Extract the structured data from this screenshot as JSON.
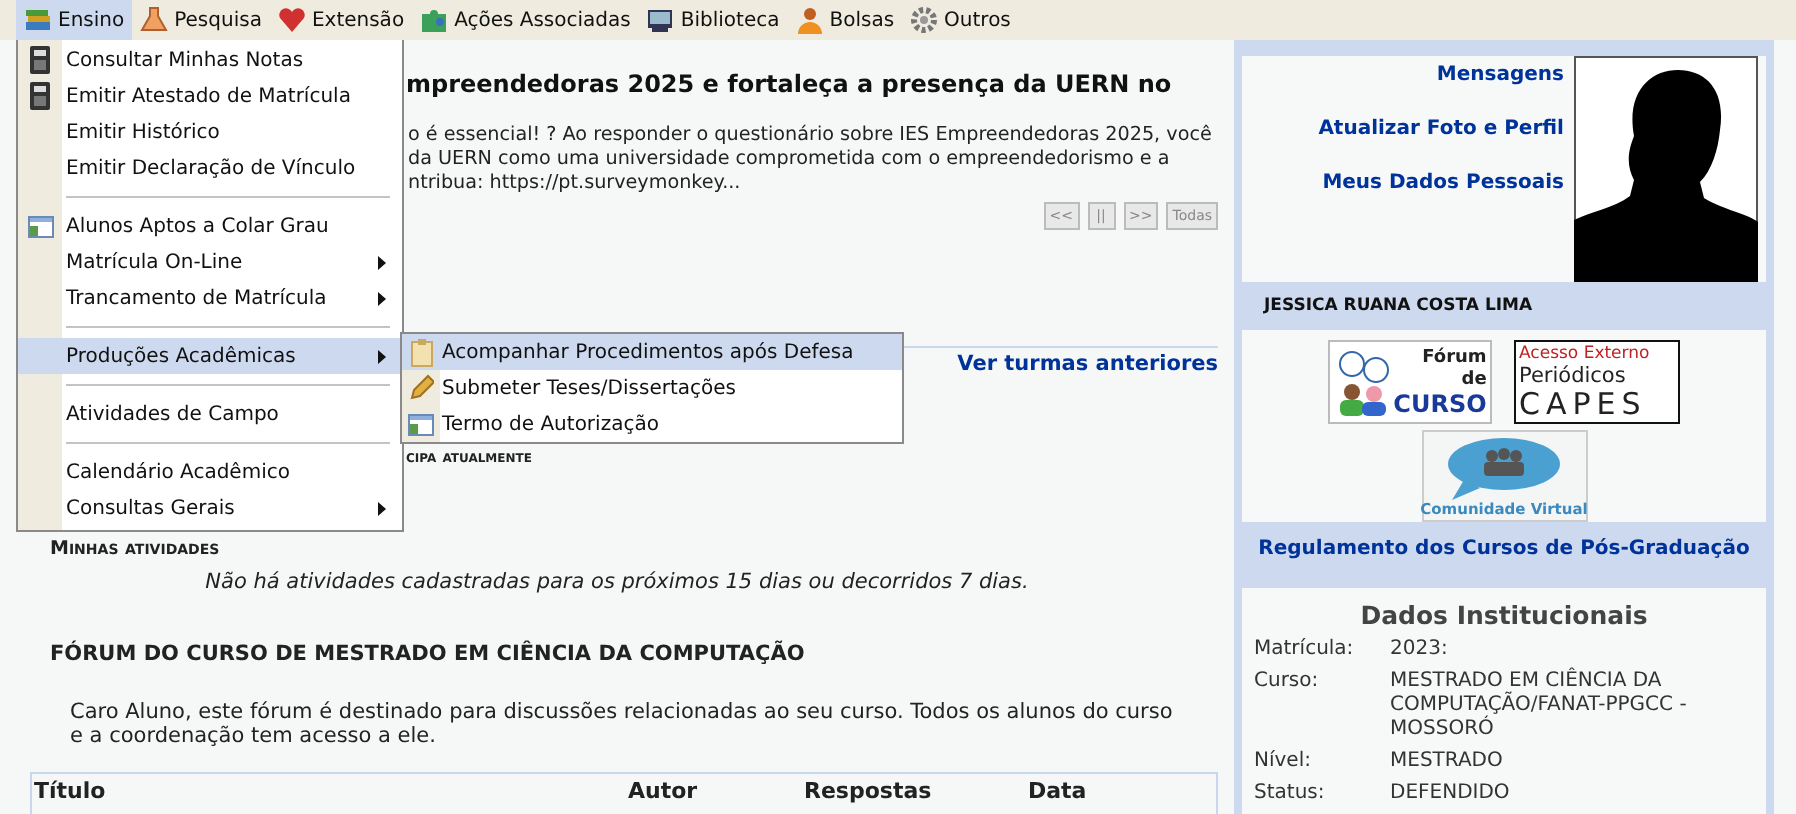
{
  "menubar": [
    {
      "label": "Ensino",
      "selected": true
    },
    {
      "label": "Pesquisa",
      "selected": false
    },
    {
      "label": "Extensão",
      "selected": false
    },
    {
      "label": "Ações Associadas",
      "selected": false
    },
    {
      "label": "Biblioteca",
      "selected": false
    },
    {
      "label": "Bolsas",
      "selected": false
    },
    {
      "label": "Outros",
      "selected": false
    }
  ],
  "dropdown": [
    {
      "kind": "item",
      "label": "Consultar Minhas Notas",
      "submenu": false,
      "selected": false
    },
    {
      "kind": "item",
      "label": "Emitir Atestado de Matrícula",
      "submenu": false,
      "selected": false
    },
    {
      "kind": "item",
      "label": "Emitir Histórico",
      "submenu": false,
      "selected": false
    },
    {
      "kind": "item",
      "label": "Emitir Declaração de Vínculo",
      "submenu": false,
      "selected": false
    },
    {
      "kind": "separator"
    },
    {
      "kind": "item",
      "label": "Alunos Aptos a Colar Grau",
      "submenu": false,
      "selected": false
    },
    {
      "kind": "item",
      "label": "Matrícula On-Line",
      "submenu": true,
      "selected": false
    },
    {
      "kind": "item",
      "label": "Trancamento de Matrícula",
      "submenu": true,
      "selected": false
    },
    {
      "kind": "separator"
    },
    {
      "kind": "item",
      "label": "Produções Acadêmicas",
      "submenu": true,
      "selected": true
    },
    {
      "kind": "separator"
    },
    {
      "kind": "item",
      "label": "Atividades de Campo",
      "submenu": false,
      "selected": false
    },
    {
      "kind": "separator"
    },
    {
      "kind": "item",
      "label": "Calendário Acadêmico",
      "submenu": false,
      "selected": false
    },
    {
      "kind": "item",
      "label": "Consultas Gerais",
      "submenu": true,
      "selected": false
    }
  ],
  "submenu": [
    {
      "label": "Acompanhar Procedimentos após Defesa",
      "selected": true
    },
    {
      "label": "Submeter Teses/Dissertações",
      "selected": false
    },
    {
      "label": "Termo de Autorização",
      "selected": false
    }
  ],
  "news": {
    "title": "mpreendedoras 2025 e fortaleça a presença da UERN no",
    "lines": [
      "o é essencial! ? Ao responder o questionário sobre IES Empreendedoras 2025, você",
      "da UERN como uma universidade comprometida com o empreendedorismo e a",
      "ntribua: https://pt.surveymonkey..."
    ],
    "controls": [
      "<<",
      "||",
      ">>",
      "Todas"
    ]
  },
  "turmas": {
    "link": "Ver turmas anteriores",
    "heading_fragment": "cipa atualmente"
  },
  "activities": {
    "heading": "Minhas atividades",
    "message": "Não há atividades cadastradas para os próximos 15 dias ou decorridos 7 dias."
  },
  "forum": {
    "title": "FÓRUM DO CURSO DE MESTRADO EM CIÊNCIA DA COMPUTAÇÃO",
    "description": "Caro Aluno, este fórum é destinado para discussões relacionadas ao seu curso. Todos os alunos do curso e a coordenação tem acesso a ele.",
    "columns": [
      "Título",
      "Autor",
      "Respostas",
      "Data"
    ]
  },
  "profile": {
    "links": [
      "Mensagens",
      "Atualizar Foto e Perfil",
      "Meus Dados Pessoais"
    ],
    "name": "JESSICA RUANA COSTA LIMA"
  },
  "logos": [
    {
      "kind": "forum",
      "lines": [
        "Fórum",
        "de",
        "CURSO"
      ]
    },
    {
      "kind": "capes",
      "lines": [
        "Acesso Externo",
        "Periódicos",
        "CAPES"
      ]
    },
    {
      "kind": "community",
      "lines": [
        "Comunidade Virtual"
      ]
    }
  ],
  "regulation_link": "Regulamento dos Cursos de Pós-Graduação",
  "institutional": {
    "title": "Dados Institucionais",
    "rows": [
      {
        "label": "Matrícula:",
        "value": "2023:"
      },
      {
        "label": "Curso:",
        "value": "MESTRADO EM CIÊNCIA DA COMPUTAÇÃO/FANAT-PPGCC - MOSSORÓ"
      },
      {
        "label": "Nível:",
        "value": "MESTRADO"
      },
      {
        "label": "Status:",
        "value": "DEFENDIDO"
      }
    ]
  }
}
